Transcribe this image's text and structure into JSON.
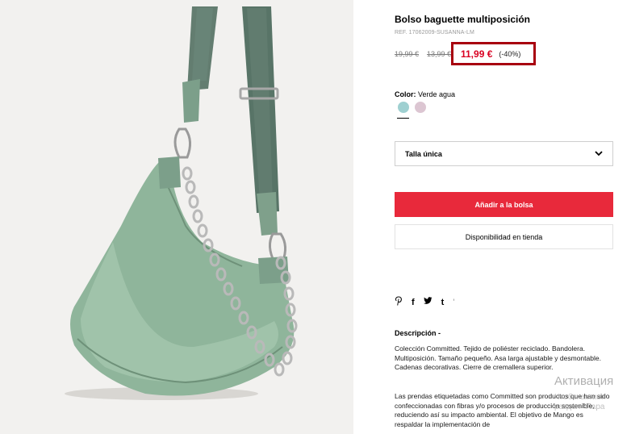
{
  "product": {
    "title": "Bolso baguette multiposición",
    "ref": "REF. 17062009-SUSANNA-LM",
    "prices": {
      "original_1": "19,99 €",
      "original_2": "13,99 €",
      "current": "11,99 €",
      "discount": "(-40%)"
    },
    "color": {
      "label": "Color:",
      "value": "Verde agua",
      "swatches": [
        {
          "name": "Verde agua",
          "hex": "#9fd0d1",
          "selected": true
        },
        {
          "name": "Rosa",
          "hex": "#dcc6d2",
          "selected": false
        }
      ]
    },
    "size_select": {
      "value": "Talla única"
    },
    "add_to_bag_label": "Añadir a la bolsa",
    "store_availability_label": "Disponibilidad en tienda"
  },
  "social": {
    "icons": [
      "pinterest-icon",
      "facebook-icon",
      "twitter-icon",
      "tumblr-icon"
    ],
    "glyphs": [
      "P",
      "f",
      "🐦",
      "t"
    ],
    "separator": "'"
  },
  "description": {
    "title": "Descripción -",
    "paragraph_1": "Colección Committed. Tejido de poliéster reciclado. Bandolera. Multiposición. Tamaño pequeño. Asa larga ajustable y desmontable. Cadenas decorativas. Cierre de cremallera superior.",
    "paragraph_2": "Las prendas etiquetadas como Committed son productos que han sido confeccionadas con fibras y/o procesos de producción sostenible, reduciendo así su impacto ambiental. El objetivo de Mango es respaldar la implementación de"
  },
  "watermark": {
    "line1": "Активация",
    "line2": "Чтобы активи",
    "line3": "раздел \"Пара"
  },
  "colors": {
    "accent_red": "#e8293b",
    "price_red": "#d90021",
    "highlight_border": "#a8000f",
    "bag_green": "#8fb39a",
    "strap_green": "#577467"
  }
}
